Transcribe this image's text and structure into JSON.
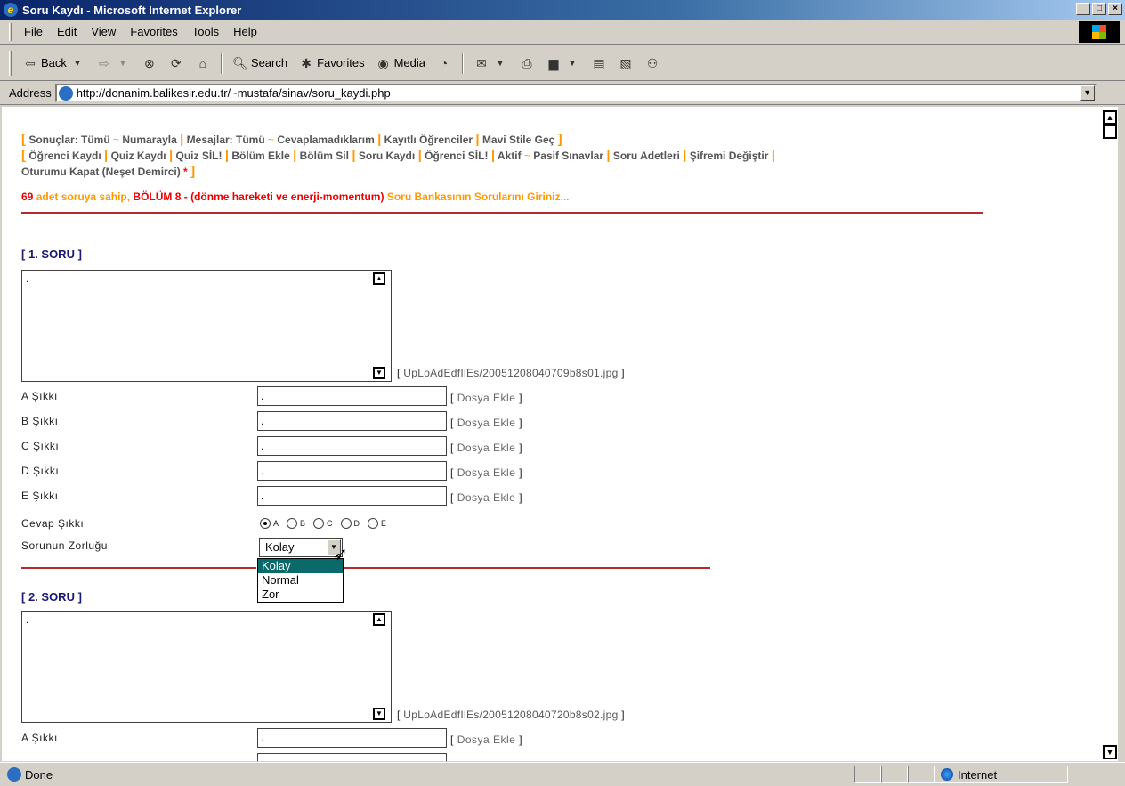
{
  "window": {
    "title": "Soru Kaydı - Microsoft Internet Explorer",
    "controls": [
      "_",
      "□",
      "×"
    ]
  },
  "menu": [
    "File",
    "Edit",
    "View",
    "Favorites",
    "Tools",
    "Help"
  ],
  "toolbar": {
    "back": "Back",
    "search": "Search",
    "favorites": "Favorites",
    "media": "Media"
  },
  "address": {
    "label": "Address",
    "url": "http://donanim.balikesir.edu.tr/~mustafa/sinav/soru_kaydi.php"
  },
  "nav": {
    "line1": [
      "Sonuçlar: Tümü",
      "Numarayla",
      "Mesajlar: Tümü",
      "Cevaplamadıklarım",
      "Kayıtlı Öğrenciler",
      "Mavi Stile Geç"
    ],
    "line2": [
      "Öğrenci Kaydı",
      "Quiz Kaydı",
      "Quiz SİL!",
      "Bölüm Ekle",
      "Bölüm Sil",
      "Soru Kaydı",
      "Öğrenci SİL!",
      "Aktif",
      "Pasif Sınavlar",
      "Soru Adetleri",
      "Şifremi Değiştir"
    ],
    "line3": "Oturumu Kapat (Neşet Demirci)",
    "star": "*"
  },
  "info": {
    "count": "69",
    "text1": "adet soruya sahip,",
    "chapter": "BÖLÜM 8 - (dönme hareketi ve enerji-momentum)",
    "text2": "Soru Bankasının Sorularını Giriniz..."
  },
  "question1": {
    "title": "[ 1. SORU ]",
    "text": ".",
    "file": "UpLoAdEdfIlEs/20051208040709b8s01.jpg",
    "options": [
      {
        "label": "A Şıkkı",
        "value": "."
      },
      {
        "label": "B Şıkkı",
        "value": "."
      },
      {
        "label": "C Şıkkı",
        "value": "."
      },
      {
        "label": "D Şıkkı",
        "value": "."
      },
      {
        "label": "E Şıkkı",
        "value": "."
      }
    ],
    "dosya": "Dosya Ekle",
    "answer_label": "Cevap Şıkkı",
    "answer_choices": [
      "A",
      "B",
      "C",
      "D",
      "E"
    ],
    "answer_selected": "A",
    "difficulty_label": "Sorunun Zorluğu",
    "difficulty_value": "Kolay",
    "difficulty_options": [
      "Kolay",
      "Normal",
      "Zor"
    ]
  },
  "question2": {
    "title": "[ 2. SORU ]",
    "text": ".",
    "file": "UpLoAdEdfIlEs/20051208040720b8s02.jpg",
    "option_a_label": "A Şıkkı",
    "option_a_value": ".",
    "dosya": "Dosya Ekle"
  },
  "status": {
    "text": "Done",
    "zone": "Internet"
  }
}
